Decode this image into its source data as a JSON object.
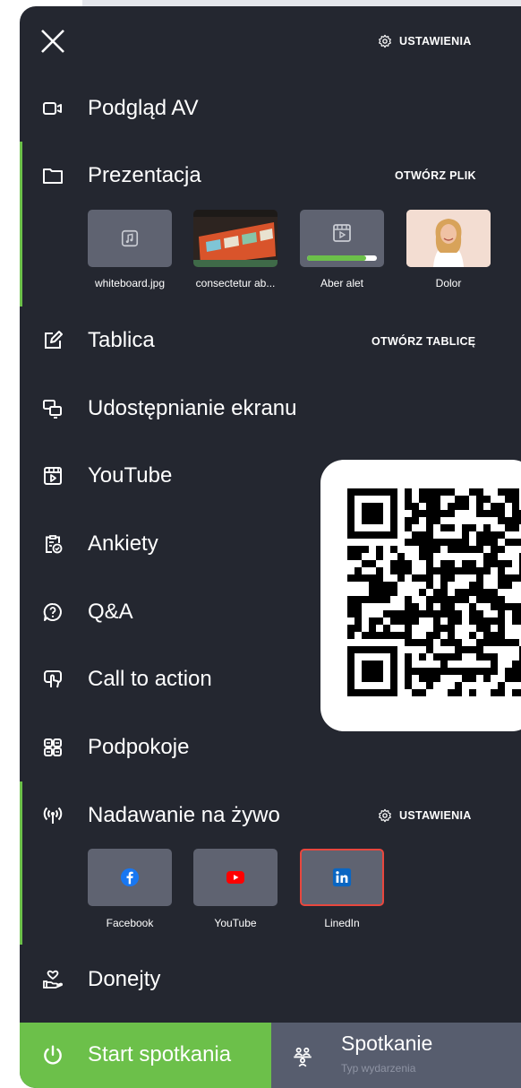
{
  "header": {
    "close_icon": "close-icon",
    "settings_label": "USTAWIENIA"
  },
  "menu": {
    "av_preview": {
      "label": "Podgląd AV",
      "icon": "camera-icon"
    },
    "presentation": {
      "label": "Prezentacja",
      "icon": "folder-icon",
      "action": "OTWÓRZ PLIK",
      "files": [
        {
          "caption": "whiteboard.jpg",
          "kind": "audio-file-icon"
        },
        {
          "caption": "consectetur ab...",
          "kind": "slide-preview"
        },
        {
          "caption": "Aber alet",
          "kind": "video-file-icon",
          "upload_progress": 0.85
        },
        {
          "caption": "Dolor",
          "kind": "person-photo"
        }
      ]
    },
    "whiteboard": {
      "label": "Tablica",
      "icon": "edit-icon",
      "action": "OTWÓRZ TABLICĘ"
    },
    "screen_share": {
      "label": "Udostępnianie ekranu",
      "icon": "screen-share-icon"
    },
    "youtube": {
      "label": "YouTube",
      "icon": "video-player-icon"
    },
    "polls": {
      "label": "Ankiety",
      "icon": "poll-icon"
    },
    "qa": {
      "label": "Q&A",
      "icon": "question-bubble-icon"
    },
    "cta": {
      "label": "Call to action",
      "icon": "touch-hand-icon"
    },
    "breakout": {
      "label": "Podpokoje",
      "icon": "grid-icon"
    },
    "live": {
      "label": "Nadawanie na żywo",
      "icon": "broadcast-icon",
      "action": "USTAWIENIA",
      "platforms": [
        {
          "caption": "Facebook",
          "icon": "facebook-icon",
          "color": "#1877f2"
        },
        {
          "caption": "YouTube",
          "icon": "youtube-icon",
          "color": "#ff0000"
        },
        {
          "caption": "LinedIn",
          "icon": "linkedin-icon",
          "color": "#0a66c2"
        }
      ]
    },
    "donations": {
      "label": "Donejty",
      "icon": "donation-icon"
    }
  },
  "footer": {
    "start_label": "Start spotkania",
    "meeting_title": "Spotkanie",
    "meeting_subtitle": "Typ wydarzenia"
  },
  "colors": {
    "panel": "#242730",
    "accent": "#6cc04a",
    "tile": "#5f6371",
    "selected_border": "#e8473e"
  }
}
